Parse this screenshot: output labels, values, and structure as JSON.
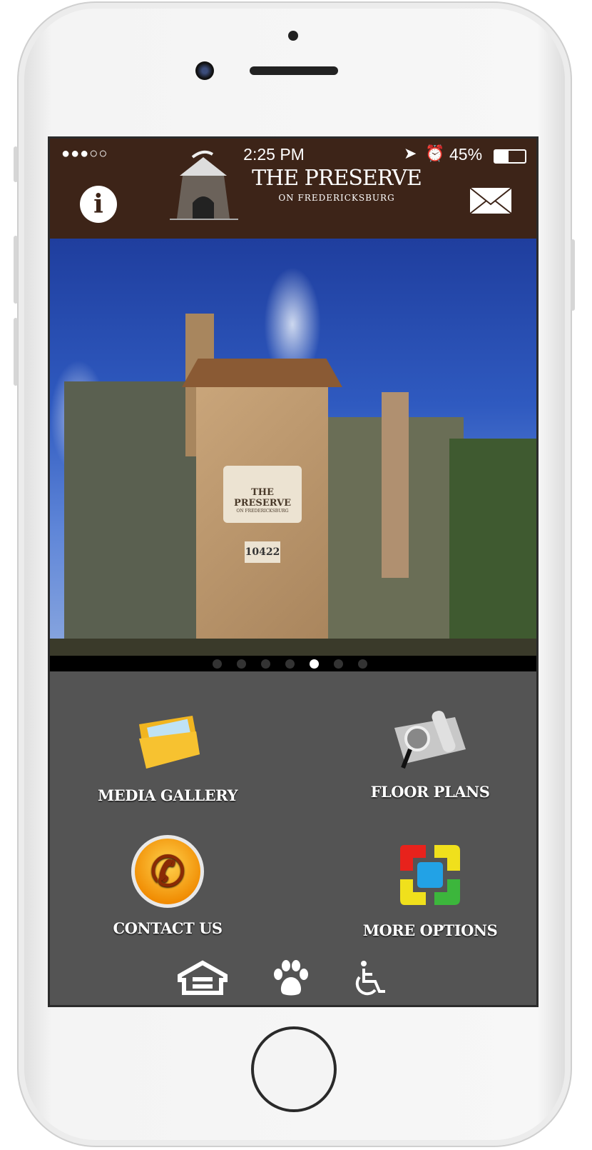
{
  "status_bar": {
    "signal": "●●●○○",
    "time": "2:25 PM",
    "battery": "45%",
    "battery_level": 0.45
  },
  "header": {
    "title": "THE PRESERVE",
    "subtitle": "ON FREDERICKSBURG",
    "info_icon": "info-icon",
    "mail_icon": "mail-icon",
    "bg": "#3d2418"
  },
  "hero": {
    "sign_title": "THE PRESERVE",
    "sign_subtitle": "ON FREDERICKSBURG",
    "sign_number": "10422",
    "slides": 7,
    "active_slide": 5
  },
  "menu": [
    {
      "label": "MEDIA GALLERY",
      "icon": "folder-photos-icon"
    },
    {
      "label": "FLOOR PLANS",
      "icon": "blueprint-magnifier-icon"
    },
    {
      "label": "CONTACT US",
      "icon": "phone-icon"
    },
    {
      "label": "MORE OPTIONS",
      "icon": "colored-squares-icon"
    }
  ],
  "footer_icons": [
    "equal-housing-icon",
    "paw-icon",
    "wheelchair-icon"
  ]
}
